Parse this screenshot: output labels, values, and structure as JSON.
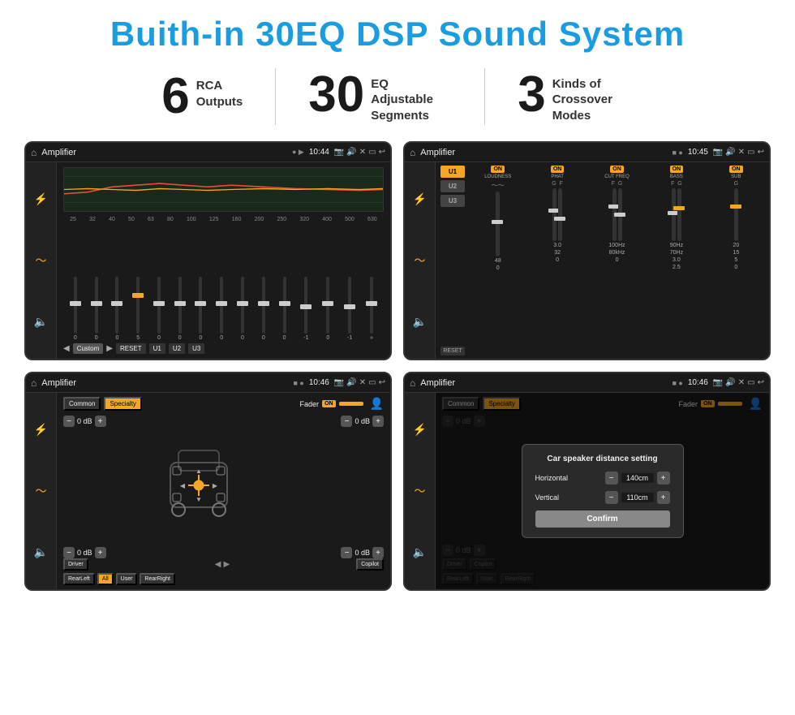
{
  "title": "Buith-in 30EQ DSP Sound System",
  "stats": [
    {
      "number": "6",
      "label": "RCA\nOutputs"
    },
    {
      "number": "30",
      "label": "EQ Adjustable\nSegments"
    },
    {
      "number": "3",
      "label": "Kinds of\nCrossover Modes"
    }
  ],
  "screens": [
    {
      "id": "eq-screen",
      "topbar": {
        "title": "Amplifier",
        "time": "10:44"
      },
      "freqs": [
        "25",
        "32",
        "40",
        "50",
        "63",
        "80",
        "100",
        "125",
        "160",
        "200",
        "250",
        "320",
        "400",
        "500",
        "630"
      ],
      "slider_vals": [
        "0",
        "0",
        "0",
        "5",
        "0",
        "0",
        "0",
        "0",
        "0",
        "0",
        "0",
        "-1",
        "0",
        "-1"
      ],
      "bottom_buttons": [
        "Custom",
        "RESET",
        "U1",
        "U2",
        "U3"
      ]
    },
    {
      "id": "crossover-screen",
      "topbar": {
        "title": "Amplifier",
        "time": "10:45"
      },
      "channels": [
        {
          "label": "ON",
          "name": "LOUDNESS"
        },
        {
          "label": "ON",
          "name": "PHAT"
        },
        {
          "label": "ON",
          "name": "CUT FREQ"
        },
        {
          "label": "ON",
          "name": "BASS"
        },
        {
          "label": "ON",
          "name": "SUB"
        }
      ],
      "u_buttons": [
        "U1",
        "U2",
        "U3"
      ],
      "reset_btn": "RESET"
    },
    {
      "id": "fader-screen",
      "topbar": {
        "title": "Amplifier",
        "time": "10:46"
      },
      "tabs": [
        "Common",
        "Specialty"
      ],
      "fader_label": "Fader",
      "fader_on": "ON",
      "positions": {
        "front_left": "0 dB",
        "front_right": "0 dB",
        "rear_left": "0 dB",
        "rear_right": "0 dB"
      },
      "bottom_buttons": [
        "Driver",
        "",
        "Copilot",
        "RearLeft",
        "All",
        "User",
        "RearRight"
      ]
    },
    {
      "id": "distance-screen",
      "topbar": {
        "title": "Amplifier",
        "time": "10:46"
      },
      "tabs": [
        "Common",
        "Specialty"
      ],
      "fader_label": "Fader",
      "fader_on": "ON",
      "dialog": {
        "title": "Car speaker distance setting",
        "horizontal_label": "Horizontal",
        "horizontal_val": "140cm",
        "vertical_label": "Vertical",
        "vertical_val": "110cm",
        "confirm_btn": "Confirm"
      },
      "right_dbs": [
        "0 dB",
        "0 dB"
      ],
      "bottom_buttons": [
        "Driver",
        "Copilot",
        "RearLeft",
        "User",
        "RearRight"
      ]
    }
  ]
}
